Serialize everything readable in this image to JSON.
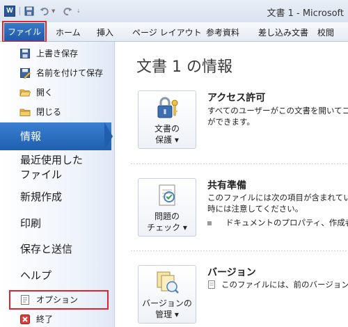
{
  "window": {
    "app_icon_letter": "W",
    "title": "文書 1 - Microsoft"
  },
  "quick_access": {
    "icons": [
      "save-icon",
      "undo-icon",
      "redo-icon",
      "customize-icon"
    ]
  },
  "ribbon": {
    "file_tab": "ファイル",
    "tabs": [
      "ホーム",
      "挿入",
      "ページ レイアウト",
      "参考資料",
      "差し込み文書",
      "校閲"
    ]
  },
  "sidebar": {
    "commands_top": [
      {
        "label": "上書き保存",
        "icon": "save-icon"
      },
      {
        "label": "名前を付けて保存",
        "icon": "save-as-icon"
      },
      {
        "label": "開く",
        "icon": "open-folder-icon"
      },
      {
        "label": "閉じる",
        "icon": "close-folder-icon"
      }
    ],
    "active_item": "情報",
    "items": [
      "最近使用した\nファイル",
      "新規作成",
      "印刷",
      "保存と送信",
      "ヘルプ"
    ],
    "commands_bottom": [
      {
        "label": "オプション",
        "icon": "options-icon"
      },
      {
        "label": "終了",
        "icon": "exit-icon"
      }
    ]
  },
  "main": {
    "heading": "文書 1 の情報",
    "sections": [
      {
        "button_label": "文書の\n保護 ▾",
        "icon": "lock-key-icon",
        "title": "アクセス許可",
        "lines": [
          "すべてのユーザーがこの文書を開いてコピ",
          "ができます。"
        ]
      },
      {
        "button_label": "問題の\nチェック ▾",
        "icon": "checklist-icon",
        "title": "共有準備",
        "lines": [
          "このファイルには次の項目が含まれていま",
          "時には注意してください。"
        ],
        "bullet": "ドキュメントのプロパティ、作成者の"
      },
      {
        "button_label": "バージョンの\n管理 ▾",
        "icon": "versions-icon",
        "title": "バージョン",
        "lines": [
          "このファイルには、前のバージョンは"
        ]
      }
    ]
  },
  "colors": {
    "accent": "#1f5fae",
    "highlight": "#e0232e"
  }
}
